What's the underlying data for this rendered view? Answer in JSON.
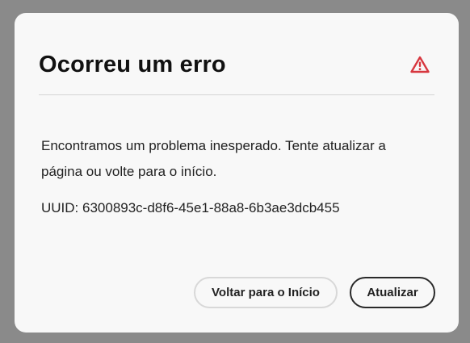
{
  "dialog": {
    "title": "Ocorreu um erro",
    "icon": "alert-triangle-icon",
    "message": "Encontramos um problema inesperado. Tente atualizar a página ou volte para o início.",
    "uuid_text": "UUID: 6300893c-d8f6-45e1-88a8-6b3ae3dcb455",
    "buttons": {
      "home_label": "Voltar para o Início",
      "refresh_label": "Atualizar"
    },
    "colors": {
      "alert": "#d7373f",
      "background": "#f8f8f8",
      "overlay": "#8a8a8a"
    }
  }
}
